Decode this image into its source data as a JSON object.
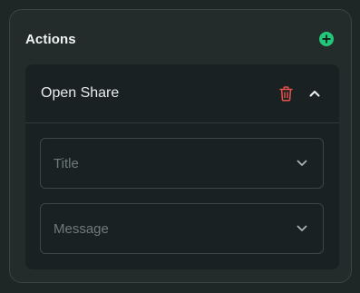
{
  "panel": {
    "title": "Actions",
    "add_icon": "plus-circle-icon",
    "accent_color": "#22c77a"
  },
  "action": {
    "title": "Open Share",
    "delete_icon": "trash-icon",
    "delete_color": "#e5534b",
    "collapse_icon": "chevron-up-icon",
    "fields": [
      {
        "placeholder": "Title",
        "icon": "chevron-down-icon"
      },
      {
        "placeholder": "Message",
        "icon": "chevron-down-icon"
      }
    ]
  }
}
